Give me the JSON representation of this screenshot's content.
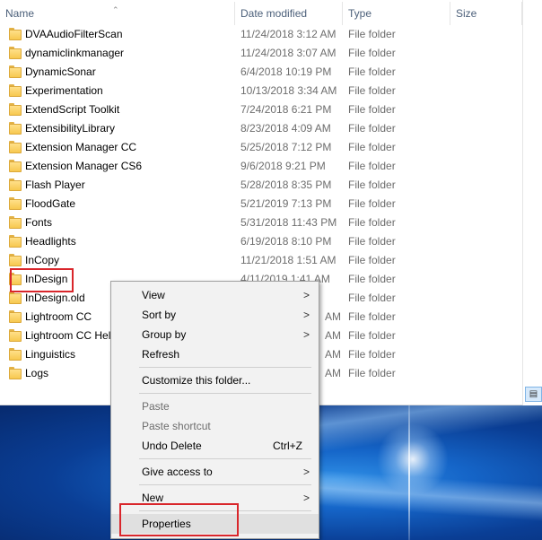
{
  "columns": {
    "name": "Name",
    "date": "Date modified",
    "type": "Type",
    "size": "Size"
  },
  "rows": [
    {
      "name": "DVAAudioFilterScan",
      "date": "11/24/2018 3:12 AM",
      "type": "File folder"
    },
    {
      "name": "dynamiclinkmanager",
      "date": "11/24/2018 3:07 AM",
      "type": "File folder"
    },
    {
      "name": "DynamicSonar",
      "date": "6/4/2018 10:19 PM",
      "type": "File folder"
    },
    {
      "name": "Experimentation",
      "date": "10/13/2018 3:34 AM",
      "type": "File folder"
    },
    {
      "name": "ExtendScript Toolkit",
      "date": "7/24/2018 6:21 PM",
      "type": "File folder"
    },
    {
      "name": "ExtensibilityLibrary",
      "date": "8/23/2018 4:09 AM",
      "type": "File folder"
    },
    {
      "name": "Extension Manager CC",
      "date": "5/25/2018 7:12 PM",
      "type": "File folder"
    },
    {
      "name": "Extension Manager CS6",
      "date": "9/6/2018 9:21 PM",
      "type": "File folder"
    },
    {
      "name": "Flash Player",
      "date": "5/28/2018 8:35 PM",
      "type": "File folder"
    },
    {
      "name": "FloodGate",
      "date": "5/21/2019 7:13 PM",
      "type": "File folder"
    },
    {
      "name": "Fonts",
      "date": "5/31/2018 11:43 PM",
      "type": "File folder"
    },
    {
      "name": "Headlights",
      "date": "6/19/2018 8:10 PM",
      "type": "File folder"
    },
    {
      "name": "InCopy",
      "date": "11/21/2018 1:51 AM",
      "type": "File folder"
    },
    {
      "name": "InDesign",
      "date": "4/11/2019 1:41 AM",
      "type": "File folder"
    },
    {
      "name": "InDesign.old",
      "date": "",
      "type": "File folder"
    },
    {
      "name": "Lightroom CC",
      "date": "AM",
      "type": "File folder"
    },
    {
      "name": "Lightroom CC Hel",
      "date": "AM",
      "type": "File folder"
    },
    {
      "name": "Linguistics",
      "date": "AM",
      "type": "File folder"
    },
    {
      "name": "Logs",
      "date": "AM",
      "type": "File folder"
    }
  ],
  "context_menu": {
    "view": "View",
    "sort_by": "Sort by",
    "group_by": "Group by",
    "refresh": "Refresh",
    "customize": "Customize this folder...",
    "paste": "Paste",
    "paste_shortcut": "Paste shortcut",
    "undo_delete": "Undo Delete",
    "undo_shortcut": "Ctrl+Z",
    "give_access": "Give access to",
    "new": "New",
    "properties": "Properties",
    "arrow": ">"
  },
  "colors": {
    "highlight_box": "#d9262b",
    "header_text": "#4c607a",
    "secondary_text": "#6d6d6d"
  },
  "icons": {
    "folder": "folder-icon",
    "submenu": "chevron-right-icon",
    "sort": "sort-up-icon"
  }
}
